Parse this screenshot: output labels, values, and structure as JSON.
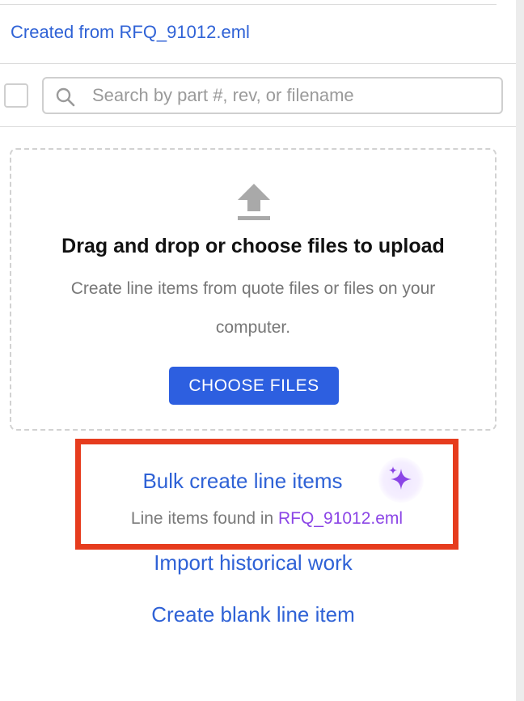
{
  "header": {
    "created_from_label": "Created from RFQ_91012.eml"
  },
  "search": {
    "placeholder": "Search by part #, rev, or filename"
  },
  "upload": {
    "title": "Drag and drop or choose files to upload",
    "description": "Create line items from quote files or files on your computer.",
    "button_label": "CHOOSE FILES"
  },
  "bulk": {
    "title": "Bulk create line items",
    "found_text": "Line items found in ",
    "found_file": "RFQ_91012.eml"
  },
  "actions": {
    "import_label": "Import historical work",
    "blank_label": "Create blank line item"
  },
  "icons": {
    "search": "search-icon",
    "upload": "upload-icon",
    "sparkle": "sparkle-icon"
  },
  "colors": {
    "link": "#2f62d6",
    "button": "#2d5fe0",
    "highlight": "#e63c1e",
    "sparkle": "#8b45e6"
  }
}
